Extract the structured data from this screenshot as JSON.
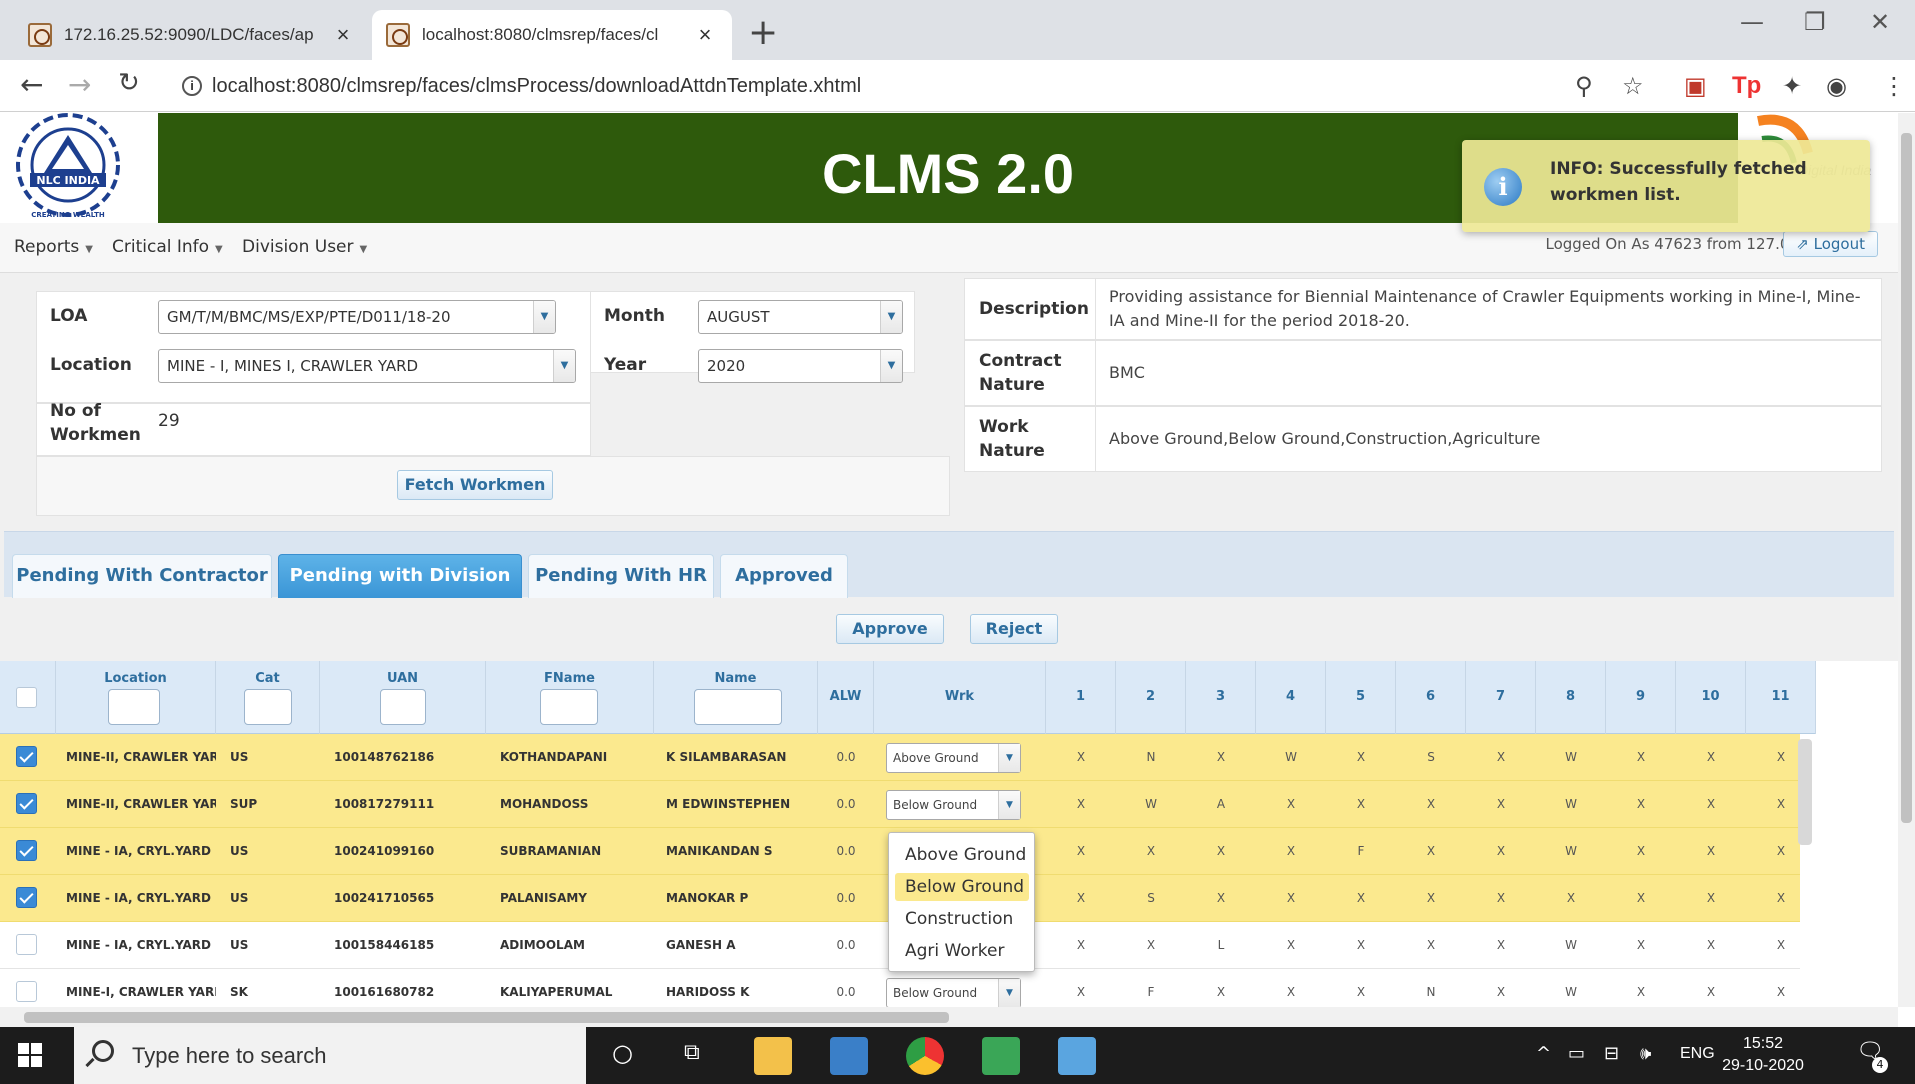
{
  "browser": {
    "tabs": [
      {
        "title": "172.16.25.52:9090/LDC/faces/ap"
      },
      {
        "title": "localhost:8080/clmsrep/faces/cl"
      }
    ],
    "url": "localhost:8080/clmsrep/faces/clmsProcess/downloadAttdnTemplate.xhtml"
  },
  "header": {
    "title": "CLMS 2.0",
    "logo_text": "NLC INDIA",
    "logo_tagline": "CREATING WEALTH FOR WELLBEING",
    "logged_on": "Logged On As 47623 from 127.0.0.1",
    "logout_label": "Logout"
  },
  "notification": {
    "text": "INFO: Successfully fetched workmen list."
  },
  "menu": [
    {
      "label": "Reports"
    },
    {
      "label": "Critical Info"
    },
    {
      "label": "Division User"
    }
  ],
  "form": {
    "loa_label": "LOA",
    "loa_value": "GM/T/M/BMC/MS/EXP/PTE/D011/18-20",
    "month_label": "Month",
    "month_value": "AUGUST",
    "location_label": "Location",
    "location_value": "MINE - I, MINES I, CRAWLER YARD",
    "year_label": "Year",
    "year_value": "2020",
    "workmen_label": "No of Workmen",
    "workmen_value": "29",
    "fetch_button": "Fetch Workmen"
  },
  "description": {
    "desc_label": "Description",
    "desc_value": "Providing assistance for Biennial Maintenance of Crawler Equipments working in Mine-I, Mine-IA and Mine-II for the period 2018-20.",
    "contract_label": "Contract Nature",
    "contract_value": "BMC",
    "work_label": "Work Nature",
    "work_value": "Above Ground,Below Ground,Construction,Agriculture"
  },
  "tabs": [
    {
      "label": "Pending With Contractor",
      "active": false
    },
    {
      "label": "Pending with Division",
      "active": true
    },
    {
      "label": "Pending With HR",
      "active": false
    },
    {
      "label": "Approved",
      "active": false
    }
  ],
  "actions": {
    "approve": "Approve",
    "reject": "Reject"
  },
  "table": {
    "columns": [
      "Location",
      "Cat",
      "UAN",
      "FName",
      "Name",
      "ALW",
      "Wrk",
      "1",
      "2",
      "3",
      "4",
      "5",
      "6",
      "7",
      "8",
      "9",
      "10",
      "11"
    ],
    "rows": [
      {
        "checked": true,
        "location": "MINE-II, CRAWLER YARI",
        "cat": "US",
        "uan": "100148762186",
        "fname": "KOTHANDAPANI",
        "name": "K SILAMBARASAN",
        "alw": "0.0",
        "wrk": "Above Ground",
        "days": [
          "X",
          "N",
          "X",
          "W",
          "X",
          "S",
          "X",
          "W",
          "X",
          "X",
          "X"
        ]
      },
      {
        "checked": true,
        "location": "MINE-II, CRAWLER YARI",
        "cat": "SUP",
        "uan": "100817279111",
        "fname": "MOHANDOSS",
        "name": "M EDWINSTEPHEN",
        "alw": "0.0",
        "wrk": "Below Ground",
        "days": [
          "X",
          "W",
          "A",
          "X",
          "X",
          "X",
          "X",
          "W",
          "X",
          "X",
          "X"
        ]
      },
      {
        "checked": true,
        "location": "MINE - IA, CRYL.YARD",
        "cat": "US",
        "uan": "100241099160",
        "fname": "SUBRAMANIAN",
        "name": "MANIKANDAN S",
        "alw": "0.0",
        "wrk": "",
        "days": [
          "X",
          "X",
          "X",
          "X",
          "F",
          "X",
          "X",
          "W",
          "X",
          "X",
          "X"
        ]
      },
      {
        "checked": true,
        "location": "MINE - IA, CRYL.YARD",
        "cat": "US",
        "uan": "100241710565",
        "fname": "PALANISAMY",
        "name": "MANOKAR P",
        "alw": "0.0",
        "wrk": "",
        "days": [
          "X",
          "S",
          "X",
          "X",
          "X",
          "X",
          "X",
          "X",
          "X",
          "X",
          "X"
        ]
      },
      {
        "checked": false,
        "location": "MINE - IA, CRYL.YARD",
        "cat": "US",
        "uan": "100158446185",
        "fname": "ADIMOOLAM",
        "name": "GANESH A",
        "alw": "0.0",
        "wrk": "",
        "days": [
          "X",
          "X",
          "L",
          "X",
          "X",
          "X",
          "X",
          "W",
          "X",
          "X",
          "X"
        ]
      },
      {
        "checked": false,
        "location": "MINE-I, CRAWLER YARE",
        "cat": "SK",
        "uan": "100161680782",
        "fname": "KALIYAPERUMAL",
        "name": "HARIDOSS K",
        "alw": "0.0",
        "wrk": "Below Ground",
        "days": [
          "X",
          "F",
          "X",
          "X",
          "X",
          "N",
          "X",
          "W",
          "X",
          "X",
          "X"
        ]
      }
    ]
  },
  "dropdown_options": [
    "Above Ground",
    "Below Ground",
    "Construction",
    "Agri Worker"
  ],
  "dropdown_highlight": "Below Ground",
  "taskbar": {
    "search_placeholder": "Type here to search",
    "lang": "ENG",
    "time": "15:52",
    "date": "29-10-2020",
    "notif_count": "4"
  },
  "colors": {
    "banner": "#2e5a0c",
    "selected_row": "#fbe98e",
    "active_tab": "#3a95d6",
    "accent": "#2e6e9e"
  }
}
